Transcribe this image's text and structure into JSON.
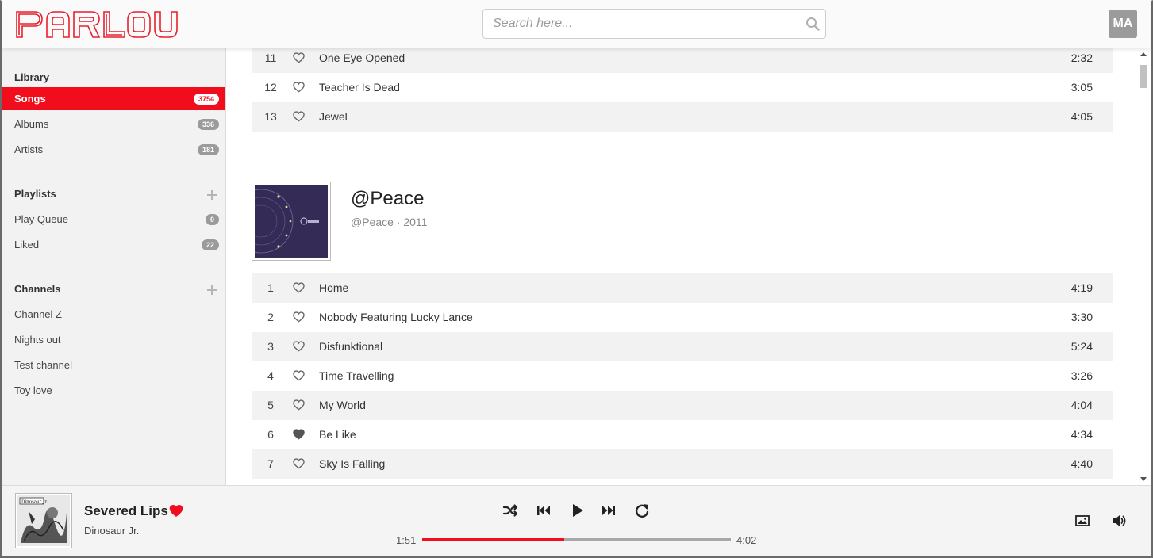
{
  "app": {
    "logo_text": "PARLOUR",
    "accent_color": "#f20d1d",
    "user_initials": "MA"
  },
  "search": {
    "placeholder": "Search here...",
    "value": ""
  },
  "sidebar": {
    "library": {
      "title": "Library",
      "items": [
        {
          "label": "Songs",
          "count": "3754",
          "active": true
        },
        {
          "label": "Albums",
          "count": "336"
        },
        {
          "label": "Artists",
          "count": "181"
        }
      ]
    },
    "playlists": {
      "title": "Playlists",
      "items": [
        {
          "label": "Play Queue",
          "count": "0"
        },
        {
          "label": "Liked",
          "count": "22"
        }
      ]
    },
    "channels": {
      "title": "Channels",
      "items": [
        {
          "label": "Channel Z"
        },
        {
          "label": "Nights out"
        },
        {
          "label": "Test channel"
        },
        {
          "label": "Toy love"
        }
      ]
    }
  },
  "main": {
    "previous_album_tracks": [
      {
        "num": "11",
        "title": "One Eye Opened",
        "duration": "2:32",
        "liked": false
      },
      {
        "num": "12",
        "title": "Teacher Is Dead",
        "duration": "3:05",
        "liked": false
      },
      {
        "num": "13",
        "title": "Jewel",
        "duration": "4:05",
        "liked": false
      }
    ],
    "album": {
      "title": "@Peace",
      "meta": "@Peace · 2011",
      "tracks": [
        {
          "num": "1",
          "title": "Home",
          "duration": "4:19",
          "liked": false
        },
        {
          "num": "2",
          "title": "Nobody Featuring Lucky Lance",
          "duration": "3:30",
          "liked": false
        },
        {
          "num": "3",
          "title": "Disfunktional",
          "duration": "5:24",
          "liked": false
        },
        {
          "num": "4",
          "title": "Time Travelling",
          "duration": "3:26",
          "liked": false
        },
        {
          "num": "5",
          "title": "My World",
          "duration": "4:04",
          "liked": false
        },
        {
          "num": "6",
          "title": "Be Like",
          "duration": "4:34",
          "liked": true
        },
        {
          "num": "7",
          "title": "Sky Is Falling",
          "duration": "4:40",
          "liked": false
        }
      ]
    }
  },
  "player": {
    "title": "Severed Lips",
    "artist": "Dinosaur Jr.",
    "cover_text": "Dinosaur Jr.",
    "liked": true,
    "elapsed": "1:51",
    "total": "4:02",
    "progress_fraction": 0.46
  }
}
